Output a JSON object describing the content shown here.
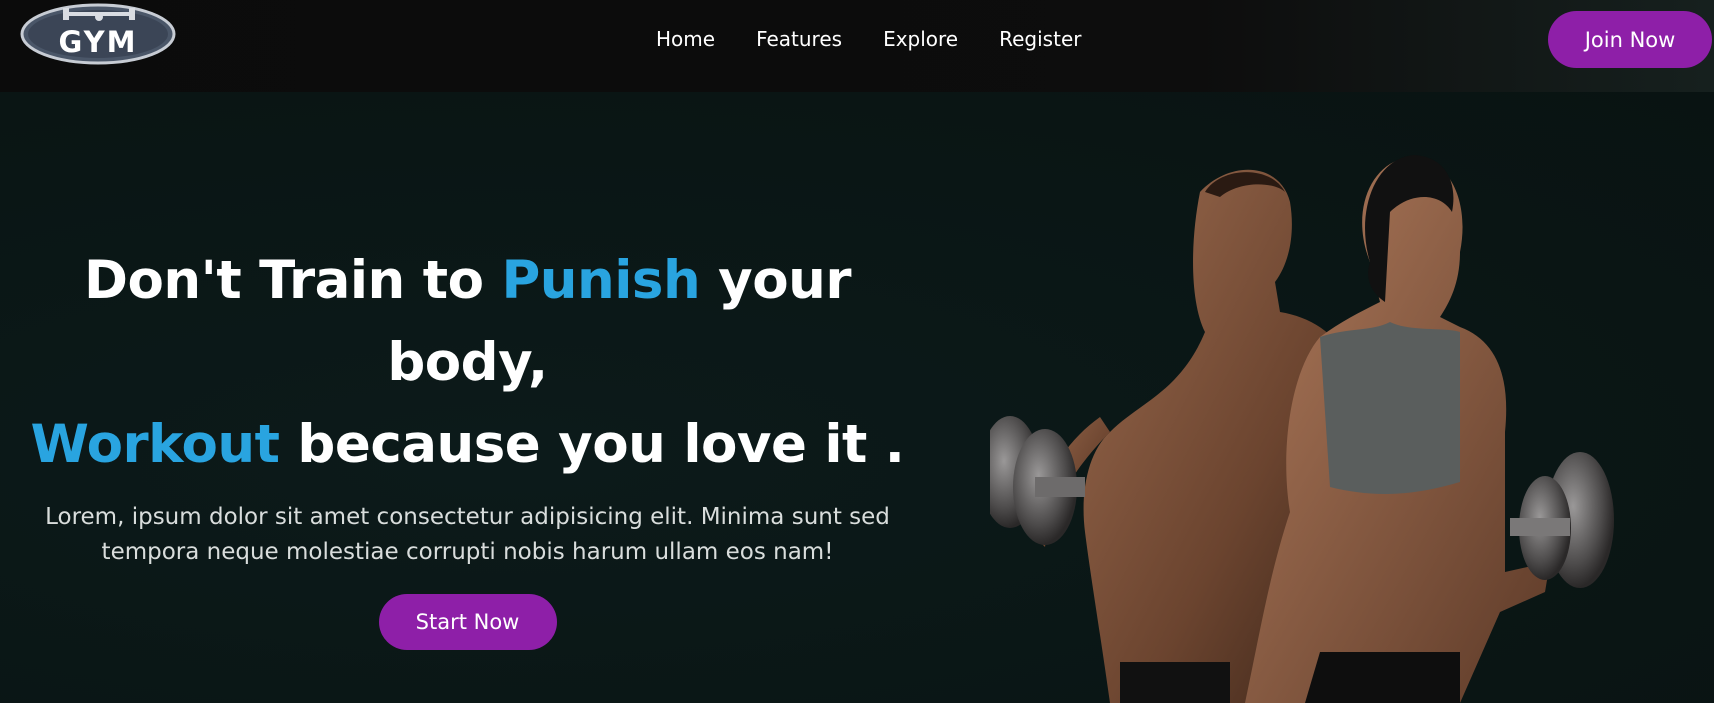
{
  "nav": {
    "logo_text": "GYM",
    "links": [
      "Home",
      "Features",
      "Explore",
      "Register"
    ],
    "cta_label": "Join Now"
  },
  "hero": {
    "headline_part1": "Don't Train to ",
    "headline_accent1": "Punish",
    "headline_part2": " your body,",
    "headline_accent2": "Workout",
    "headline_part3": " because you love it .",
    "description": "Lorem, ipsum dolor sit amet consectetur adipisicing elit. Minima sunt sed tempora neque molestiae corrupti nobis harum ullam eos nam!",
    "cta_label": "Start Now"
  },
  "colors": {
    "accent": "#29a4e0",
    "button": "#8e1fa8",
    "background": "#0b1716"
  }
}
